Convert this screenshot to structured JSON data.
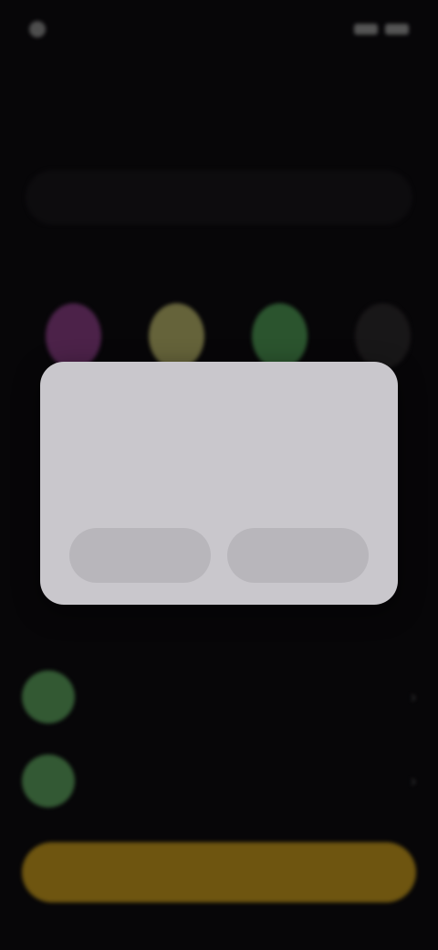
{
  "status_bar": {
    "time": "",
    "indicators": ""
  },
  "headline": {
    "title": "",
    "subtitle": ""
  },
  "account_pill": {
    "label": ""
  },
  "section": {
    "label": ""
  },
  "avatars": [
    {
      "color": "#8a3f86"
    },
    {
      "color": "#b8b46a"
    },
    {
      "color": "#4f9a55"
    },
    {
      "color": "#2d2a2c"
    }
  ],
  "list_items": [
    {
      "label": "",
      "color": "#5da35e"
    },
    {
      "label": "",
      "color": "#5ea35f"
    }
  ],
  "bottom_cta": {
    "label": "",
    "color": "#c89b1e"
  },
  "dialog": {
    "title": "",
    "body": "",
    "button_left": "",
    "button_right": ""
  },
  "colors": {
    "background": "#0d0b0f",
    "dialog": "#c9c7cc",
    "accent": "#c89b1e"
  }
}
